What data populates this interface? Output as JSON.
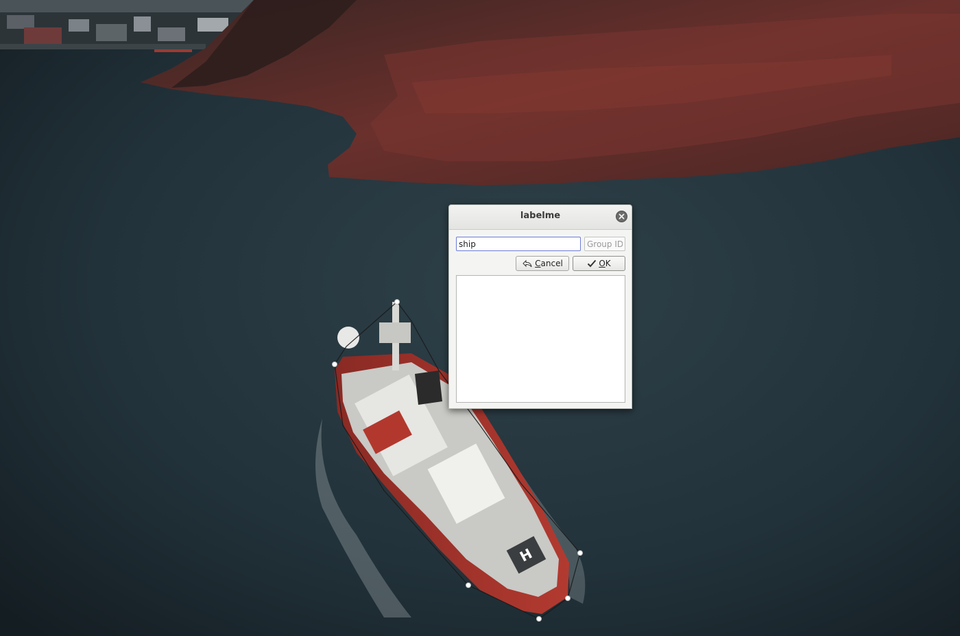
{
  "dialog": {
    "title": "labelme",
    "label_value": "ship",
    "group_id_placeholder": "Group ID",
    "cancel_label": "Cancel",
    "cancel_mnemonic": "C",
    "cancel_rest": "ancel",
    "ok_label": "OK",
    "ok_mnemonic": "O",
    "ok_rest": "K",
    "label_list": []
  },
  "canvas": {
    "image_subject": "aerial photo of red and white ship near rocky coast",
    "annotation_label": "ship"
  },
  "colors": {
    "water": "#23323a",
    "land": "#5a2a28",
    "ship_hull": "#a5342c",
    "ship_deck": "#dcdcd8",
    "dialog_bg": "#f4f5f3",
    "input_focus_border": "#6b7bd6"
  }
}
